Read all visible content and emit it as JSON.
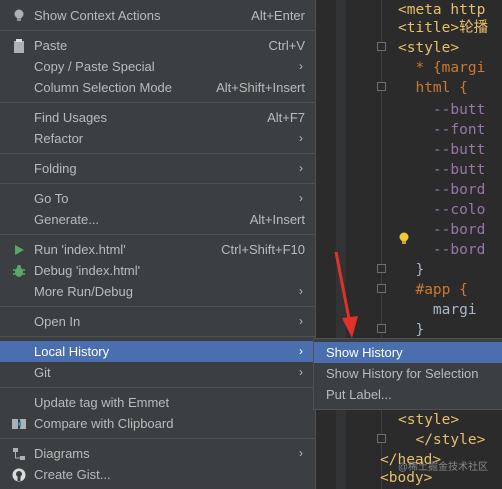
{
  "menu": {
    "items": [
      {
        "label": "Show Context Actions",
        "shortcut": "Alt+Enter",
        "icon": "lightbulb-icon"
      },
      {
        "label": "Paste",
        "shortcut": "Ctrl+V",
        "icon": "clipboard-icon"
      },
      {
        "label": "Copy / Paste Special",
        "submenu": true
      },
      {
        "label": "Column Selection Mode",
        "shortcut": "Alt+Shift+Insert"
      },
      {
        "label": "Find Usages",
        "shortcut": "Alt+F7"
      },
      {
        "label": "Refactor",
        "submenu": true
      },
      {
        "label": "Folding",
        "submenu": true
      },
      {
        "label": "Go To",
        "submenu": true
      },
      {
        "label": "Generate...",
        "shortcut": "Alt+Insert"
      },
      {
        "label": "Run 'index.html'",
        "shortcut": "Ctrl+Shift+F10",
        "icon": "run-icon"
      },
      {
        "label": "Debug 'index.html'",
        "icon": "debug-bug-icon"
      },
      {
        "label": "More Run/Debug",
        "submenu": true
      },
      {
        "label": "Open In",
        "submenu": true
      },
      {
        "label": "Local History",
        "submenu": true,
        "active": true
      },
      {
        "label": "Git",
        "submenu": true
      },
      {
        "label": "Update tag with Emmet"
      },
      {
        "label": "Compare with Clipboard",
        "icon": "compare-icon"
      },
      {
        "label": "Diagrams",
        "submenu": true,
        "icon": "diagram-icon"
      },
      {
        "label": "Create Gist...",
        "icon": "github-icon"
      }
    ],
    "arrow_glyph": "›"
  },
  "submenu": {
    "items": [
      {
        "label": "Show History",
        "active": true
      },
      {
        "label": "Show History for Selection"
      },
      {
        "label": "Put Label..."
      }
    ]
  },
  "editor": {
    "lines": [
      {
        "text": "<meta http"
      },
      {
        "text": "<title>轮播"
      },
      {
        "text": "<style>"
      },
      {
        "text": "  * {margi"
      },
      {
        "text": "  html {"
      },
      {
        "text": "    --butt"
      },
      {
        "text": "    --font"
      },
      {
        "text": "    --butt"
      },
      {
        "text": "    --butt"
      },
      {
        "text": "    --bord"
      },
      {
        "text": "    --colo"
      },
      {
        "text": "    --bord"
      },
      {
        "text": "    --bord"
      },
      {
        "text": "  }"
      },
      {
        "text": "  #app {"
      },
      {
        "text": "    margi"
      },
      {
        "text": "  }"
      },
      {
        "text": "<style>"
      },
      {
        "text": "  </style>"
      },
      {
        "text": "</head>"
      },
      {
        "text": "<body>"
      }
    ]
  },
  "watermark": "@稀土掘金技术社区",
  "colors": {
    "menu_bg": "#3c3f41",
    "selection": "#4b6eaf",
    "editor_bg": "#2b2b2b",
    "annotation_arrow": "#e0322b"
  }
}
